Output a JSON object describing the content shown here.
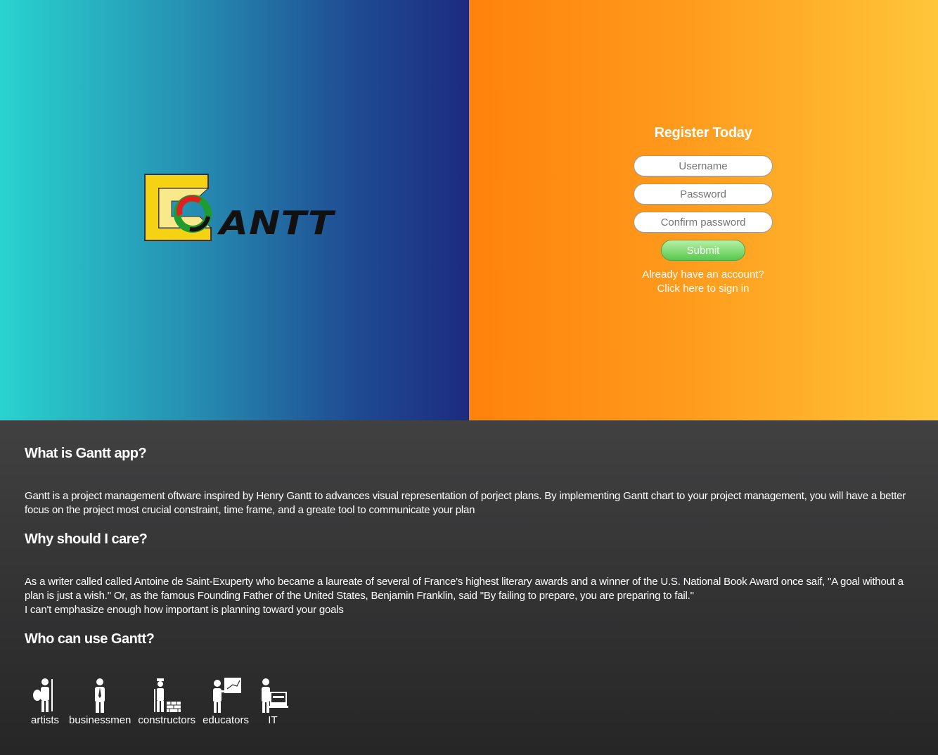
{
  "brand": {
    "logo_text": "ANTT"
  },
  "register": {
    "title": "Register Today",
    "username_placeholder": "Username",
    "password_placeholder": "Password",
    "confirm_placeholder": "Confirm password",
    "submit_label": "Submit",
    "signin_line1": "Already have an account?",
    "signin_line2": "Click here to sign in"
  },
  "sections": [
    {
      "title": "What is Gantt app?",
      "text": "Gantt is a project management oftware inspired by Henry Gantt to advances visual representation of porject plans. By implementing Gantt chart to your project management, you will have a better focus on the project most crucial constraint, time frame, and a greate tool to communicate your plan"
    },
    {
      "title": "Why should I care?",
      "text": "As a writer called called Antoine de Saint-Exuperty who became a laureate of several of France's highest literary awards and a winner of the U.S. National Book Award once saif, \"A goal without a plan is just a wish.\" Or, as the famous Founding Father of the United States, Benjamin Franklin, said \"By failing to prepare, you are preparing to fail.\"",
      "text2": "I can't emphasize enough how important is planning toward your goals"
    },
    {
      "title": "Who can use Gantt?"
    }
  ],
  "users": [
    {
      "label": "artists",
      "icon": "artist-icon"
    },
    {
      "label": "businessmen",
      "icon": "businessman-icon"
    },
    {
      "label": "constructors",
      "icon": "constructor-icon"
    },
    {
      "label": "educators",
      "icon": "educator-icon"
    },
    {
      "label": "IT",
      "icon": "it-worker-icon"
    }
  ]
}
